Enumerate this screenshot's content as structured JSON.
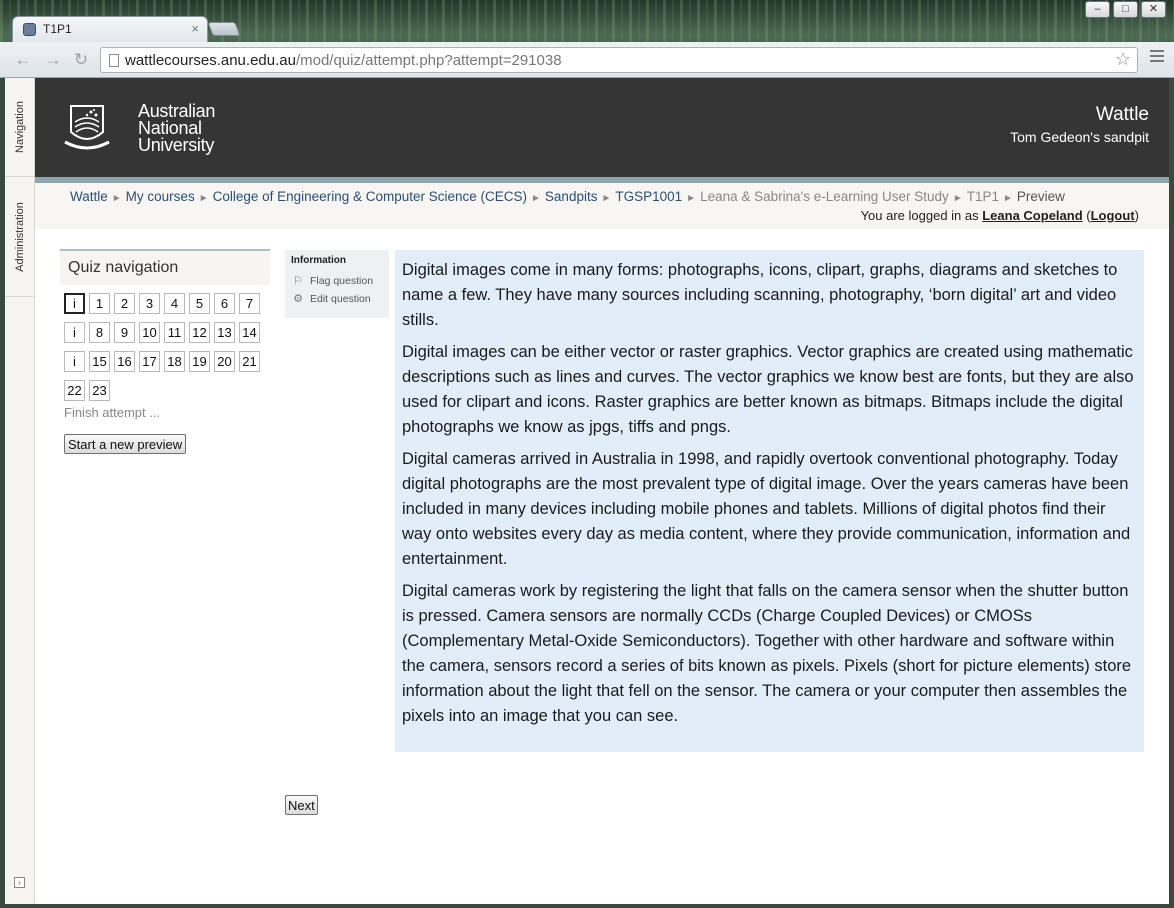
{
  "browser": {
    "tab_title": "T1P1",
    "url_host": "wattlecourses.anu.edu.au",
    "url_path": "/mod/quiz/attempt.php?attempt=291038"
  },
  "dock": {
    "items": [
      {
        "label": "Navigation"
      },
      {
        "label": "Administration"
      }
    ]
  },
  "header": {
    "logo_lines": [
      "Australian",
      "National",
      "University"
    ],
    "site_title": "Wattle",
    "site_subtitle": "Tom Gedeon's sandpit"
  },
  "breadcrumb": {
    "items": [
      "Wattle",
      "My courses",
      "College of Engineering & Computer Science (CECS)",
      "Sandpits",
      "TGSP1001",
      "Leana & Sabrina's e-Learning User Study",
      "T1P1",
      "Preview"
    ],
    "separator": "►"
  },
  "login": {
    "prefix": "You are logged in as ",
    "user": "Leana Copeland",
    "logout": "Logout"
  },
  "quiz_nav": {
    "title": "Quiz navigation",
    "buttons": [
      "i",
      "1",
      "2",
      "3",
      "4",
      "5",
      "6",
      "7",
      "i",
      "8",
      "9",
      "10",
      "11",
      "12",
      "13",
      "14",
      "i",
      "15",
      "16",
      "17",
      "18",
      "19",
      "20",
      "21",
      "22",
      "23"
    ],
    "finish": "Finish attempt ...",
    "new_preview": "Start a new preview"
  },
  "info_panel": {
    "title": "Information",
    "flag": "Flag question",
    "edit": "Edit question"
  },
  "content": {
    "paragraphs": [
      "Digital images come in many forms: photographs, icons, clipart, graphs, diagrams and sketches to name a few. They have many sources including scanning, photography, ‘born digital’ art and video stills.",
      "Digital images can be either vector or raster graphics. Vector graphics are created using mathematic descriptions such as lines and curves. The vector graphics we know best are fonts, but they are also used for clipart and icons. Raster graphics are better known as bitmaps. Bitmaps include the digital photographs we know as jpgs, tiffs and pngs.",
      "Digital cameras arrived in Australia in 1998, and rapidly overtook conventional photography. Today digital photographs are the most prevalent type of digital image. Over the years cameras have been included in many devices including mobile phones and tablets. Millions of digital photos find their way onto websites every day as media content, where they provide communication, information and entertainment.",
      "Digital cameras work by registering the light that falls on the camera sensor when the shutter button is pressed. Camera sensors are normally CCDs (Charge Coupled Devices) or CMOSs (Complementary Metal-Oxide Semiconductors). Together with other hardware and software within the camera, sensors record a series of bits known as pixels. Pixels (short for picture elements) store information about the light that fell on the sensor. The camera or your computer then assembles the pixels into an image that you can see."
    ]
  },
  "next_label": "Next",
  "colors": {
    "header_bg": "#353535",
    "content_bg": "#e1eef9",
    "link": "#2a4f7a"
  }
}
